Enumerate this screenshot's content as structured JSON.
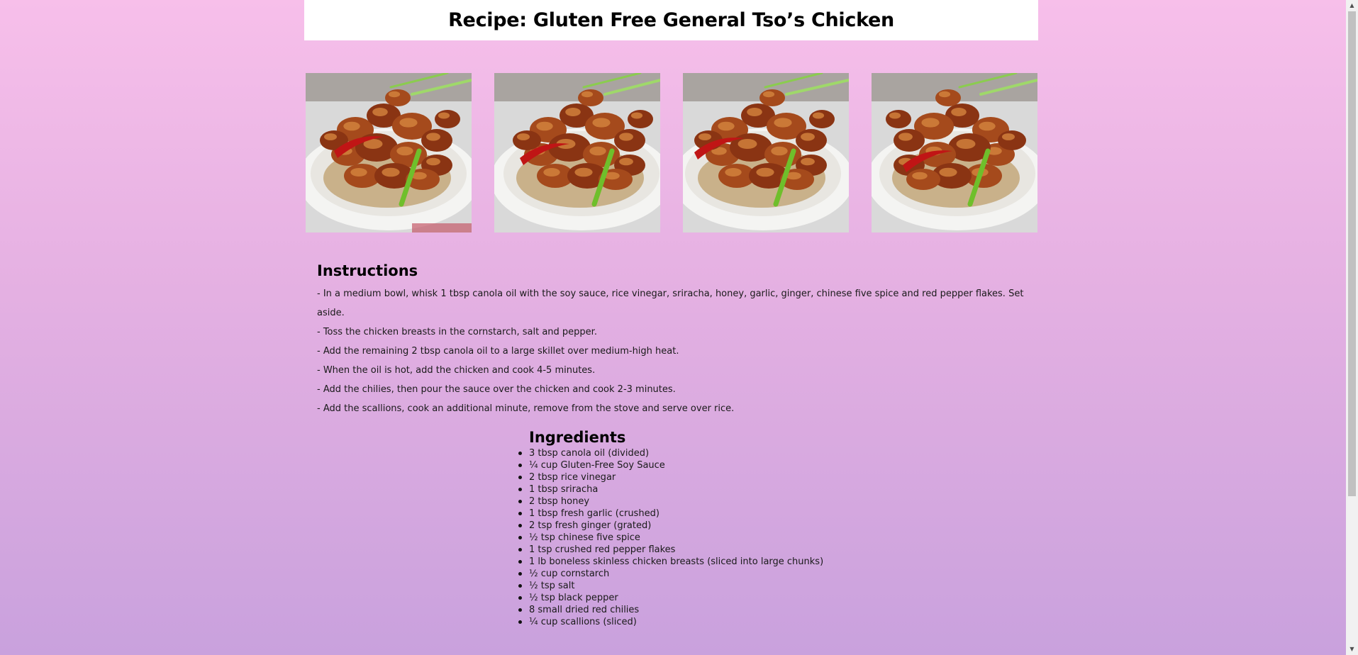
{
  "page": {
    "title": "Recipe: Gluten Free General Tso’s Chicken"
  },
  "gallery": {
    "images": [
      {
        "name": "chicken-photo-1"
      },
      {
        "name": "chicken-photo-2"
      },
      {
        "name": "chicken-photo-3"
      },
      {
        "name": "chicken-photo-4"
      }
    ]
  },
  "instructions": {
    "heading": "Instructions",
    "steps": [
      "- In a medium bowl, whisk 1 tbsp canola oil with the soy sauce, rice vinegar, sriracha, honey, garlic, ginger, chinese five spice and red pepper flakes. Set aside.",
      "- Toss the chicken breasts in the cornstarch, salt and pepper.",
      "- Add the remaining 2 tbsp canola oil to a large skillet over medium-high heat.",
      "- When the oil is hot, add the chicken and cook 4-5 minutes.",
      "- Add the chilies, then pour the sauce over the chicken and cook 2-3 minutes.",
      "- Add the scallions, cook an additional minute, remove from the stove and serve over rice."
    ]
  },
  "ingredients": {
    "heading": "Ingredients",
    "items": [
      "3 tbsp canola oil (divided)",
      "¼ cup Gluten-Free Soy Sauce",
      "2 tbsp rice vinegar",
      "1 tbsp sriracha",
      "2 tbsp honey",
      "1 tbsp fresh garlic (crushed)",
      "2 tsp fresh ginger (grated)",
      "½ tsp chinese five spice",
      "1 tsp crushed red pepper flakes",
      "1 lb boneless skinless chicken breasts (sliced into large chunks)",
      "½ cup cornstarch",
      "½ tsp salt",
      "½ tsp black pepper",
      "8 small dried red chilies",
      "¼ cup scallions (sliced)"
    ]
  },
  "scrollbar": {
    "up_arrow": "▲",
    "down_arrow": "▼"
  },
  "colors": {
    "background_top": "#f7bfea",
    "background_bottom": "#c9a1dd",
    "title_bar": "#ffffff"
  }
}
